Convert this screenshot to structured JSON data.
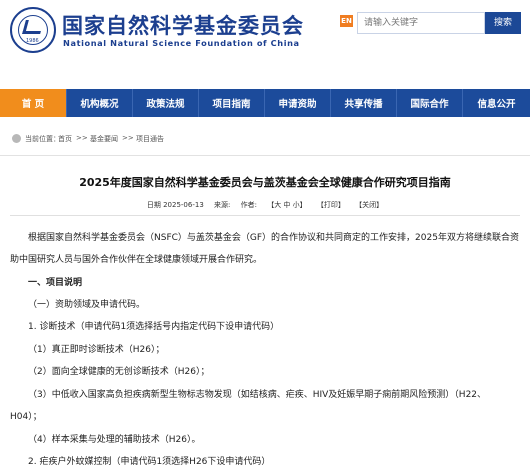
{
  "header": {
    "title": "国家自然科学基金委员会",
    "subtitle": "National Natural Science Foundation of China",
    "seal_year": "1986",
    "lang_badge": "EN",
    "search_placeholder": "请输入关键字",
    "search_button": "搜索"
  },
  "colors": {
    "brand": "#1c3f8f",
    "nav": "#1c4b9b",
    "accent": "#f18d1c"
  },
  "nav": [
    {
      "label": "首  页"
    },
    {
      "label": "机构概况"
    },
    {
      "label": "政策法规"
    },
    {
      "label": "项目指南"
    },
    {
      "label": "申请资助"
    },
    {
      "label": "共享传播"
    },
    {
      "label": "国际合作"
    },
    {
      "label": "信息公开"
    }
  ],
  "breadcrumb": {
    "prefix": "当前位置：",
    "home": "首页",
    "sep1": ">>",
    "level1": "基金要闻",
    "sep2": ">>",
    "level2": "项目通告"
  },
  "article": {
    "title": "2025年度国家自然科学基金委员会与盖茨基金会全球健康合作研究项目指南",
    "date_label": "日期",
    "date": "2025-06-13",
    "source_label": "来源:",
    "author_label": "作者:",
    "font_size": "【大 中 小】",
    "print": "【打印】",
    "close": "【关闭】",
    "intro1": "根据国家自然科学基金委员会（NSFC）与盖茨基金会（GF）的合作协议和共同商定的工作安排，2025年双方将继续联合资",
    "intro2": "助中国研究人员与国外合作伙伴在全球健康领域开展合作研究。",
    "section1": "一、项目说明",
    "sub1": "（一）资助领域及申请代码。",
    "item1": "1. 诊断技术（申请代码1须选择括号内指定代码下设申请代码）",
    "item1a": "（1）真正即时诊断技术（H26）；",
    "item1b": "（2）面向全球健康的无创诊断技术（H26）；",
    "item1c": "（3）中低收入国家高负担疾病新型生物标志物发现（如结核病、疟疾、HIV及妊娠早期子痫前期风险预测）（H22、",
    "item1c2": "H04）；",
    "item1d": "（4）样本采集与处理的辅助技术（H26）。",
    "item2": "2. 疟疾户外蚊媒控制（申请代码1须选择H26下设申请代码）"
  }
}
